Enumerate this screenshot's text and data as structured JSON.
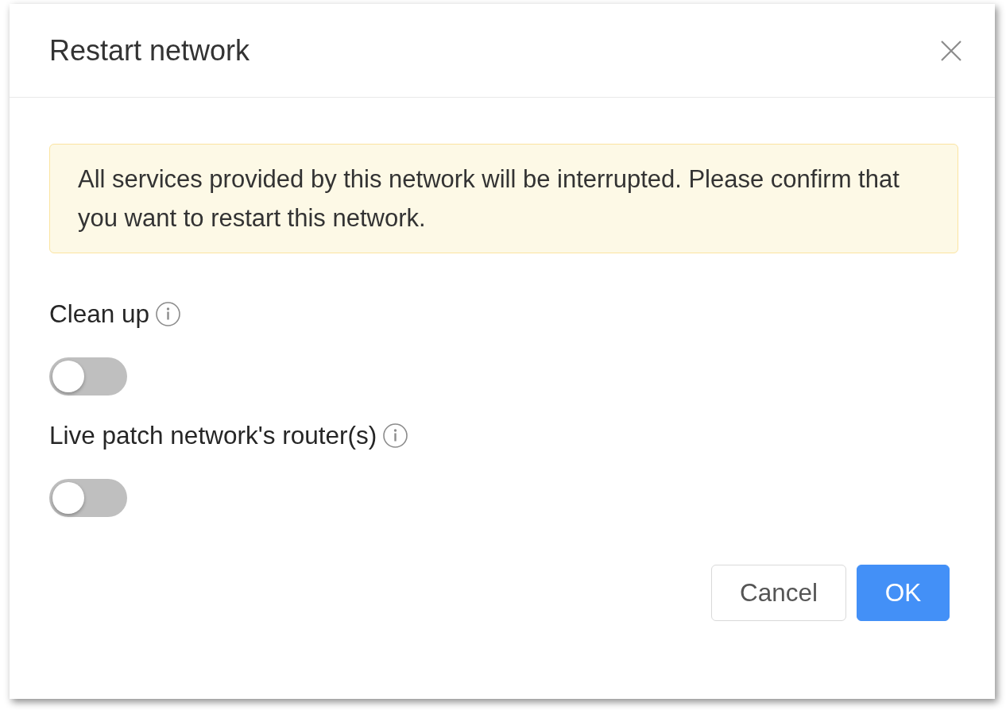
{
  "dialog": {
    "title": "Restart network"
  },
  "alert": {
    "text": "All services provided by this network will be interrupted. Please confirm that you want to restart this network."
  },
  "options": [
    {
      "label": "Clean up",
      "on": false
    },
    {
      "label": "Live patch network's router(s)",
      "on": false
    }
  ],
  "buttons": [
    {
      "label": "Cancel",
      "kind": "default"
    },
    {
      "label": "OK",
      "kind": "primary"
    }
  ]
}
